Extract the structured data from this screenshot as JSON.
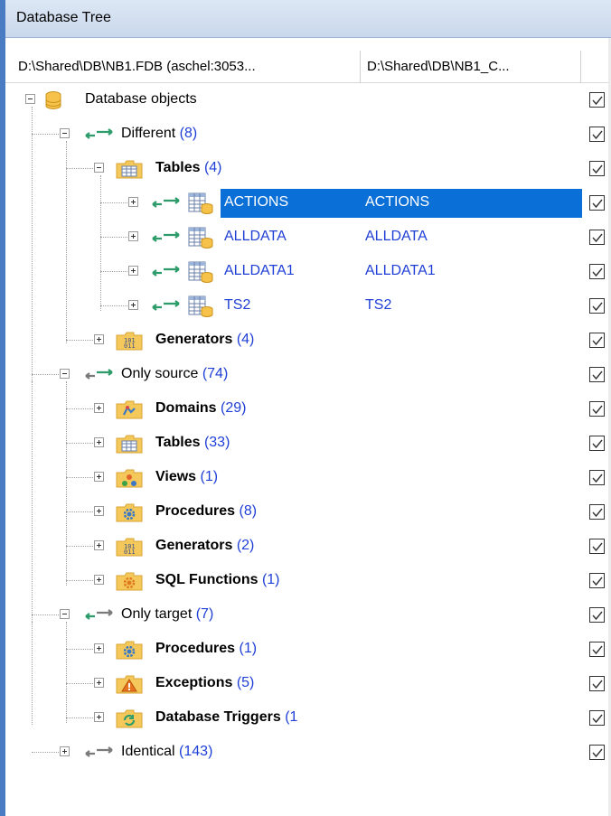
{
  "panel": {
    "title": "Database Tree"
  },
  "columns": [
    {
      "label": "D:\\Shared\\DB\\NB1.FDB (aschel:3053..."
    },
    {
      "label": "D:\\Shared\\DB\\NB1_C..."
    }
  ],
  "tree": {
    "root": {
      "label": "Database objects",
      "checked": true
    },
    "different": {
      "label": "Different",
      "count": "(8)",
      "tables": {
        "label": "Tables",
        "count": "(4)",
        "items": [
          {
            "source": "ACTIONS",
            "target": "ACTIONS",
            "selected": true
          },
          {
            "source": "ALLDATA",
            "target": "ALLDATA"
          },
          {
            "source": "ALLDATA1",
            "target": "ALLDATA1"
          },
          {
            "source": "TS2",
            "target": "TS2"
          }
        ]
      },
      "generators": {
        "label": "Generators",
        "count": "(4)"
      }
    },
    "only_source": {
      "label": "Only source",
      "count": "(74)",
      "items": [
        {
          "label": "Domains",
          "count": "(29)",
          "icon": "domains-icon"
        },
        {
          "label": "Tables",
          "count": "(33)",
          "icon": "table-icon"
        },
        {
          "label": "Views",
          "count": "(1)",
          "icon": "views-icon"
        },
        {
          "label": "Procedures",
          "count": "(8)",
          "icon": "procedure-gear-icon"
        },
        {
          "label": "Generators",
          "count": "(2)",
          "icon": "generator-icon"
        },
        {
          "label": "SQL Functions",
          "count": "(1)",
          "icon": "sql-function-icon"
        }
      ]
    },
    "only_target": {
      "label": "Only target",
      "count": "(7)",
      "items": [
        {
          "label": "Procedures",
          "count": "(1)",
          "icon": "procedure-gear-icon"
        },
        {
          "label": "Exceptions",
          "count": "(5)",
          "icon": "warning-icon"
        },
        {
          "label": "Database Triggers",
          "count": "(1",
          "icon": "trigger-icon"
        }
      ]
    },
    "identical": {
      "label": "Identical",
      "count": "(143)"
    }
  },
  "colors": {
    "selection": "#0a6fd6",
    "count_blue": "#1f3fd6",
    "diff_arrow_green": "#2e9c6a",
    "arrow_gray": "#7a7a7a",
    "folder": "#f4c85a"
  }
}
